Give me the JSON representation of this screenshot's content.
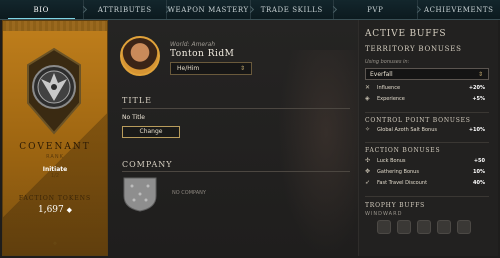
{
  "nav": {
    "tabs": [
      {
        "label": "BIO",
        "active": true
      },
      {
        "label": "ATTRIBUTES",
        "active": false
      },
      {
        "label": "WEAPON MASTERY",
        "active": false
      },
      {
        "label": "TRADE SKILLS",
        "active": false
      },
      {
        "label": "PVP",
        "active": false
      },
      {
        "label": "ACHIEVEMENTS",
        "active": false
      }
    ]
  },
  "faction": {
    "name": "COVENANT",
    "rank_label": "RANK",
    "rank": "Initiate",
    "rank_sub": "1/2",
    "tokens_label": "FACTION TOKENS",
    "tokens": "1,697",
    "accent_color": "#b97a18"
  },
  "character": {
    "world": "World: Amerah",
    "name": "Tonton RidM",
    "pronoun": "He/Him"
  },
  "title_section": {
    "heading": "TITLE",
    "value": "No Title",
    "change_label": "Change"
  },
  "company": {
    "heading": "COMPANY",
    "value": "NO COMPANY"
  },
  "buffs": {
    "heading": "ACTIVE BUFFS",
    "territory_heading": "TERRITORY BONUSES",
    "using_label": "Using bonuses in:",
    "settlement": "Everfall",
    "territory_rows": [
      {
        "icon": "✕",
        "label": "Influence",
        "value": "+20%"
      },
      {
        "icon": "◈",
        "label": "Experience",
        "value": "+5%"
      }
    ],
    "control_heading": "CONTROL POINT BONUSES",
    "control_rows": [
      {
        "icon": "✧",
        "label": "Global Azoth Salt Bonus",
        "value": "+10%"
      }
    ],
    "faction_heading": "FACTION BONUSES",
    "faction_rows": [
      {
        "icon": "✣",
        "label": "Luck Bonus",
        "value": "+50"
      },
      {
        "icon": "✥",
        "label": "Gathering Bonus",
        "value": "10%"
      },
      {
        "icon": "➶",
        "label": "Fast Travel Discount",
        "value": "40%"
      }
    ],
    "trophy_heading": "TROPHY BUFFS",
    "trophy_sub": "WINDWARD"
  }
}
